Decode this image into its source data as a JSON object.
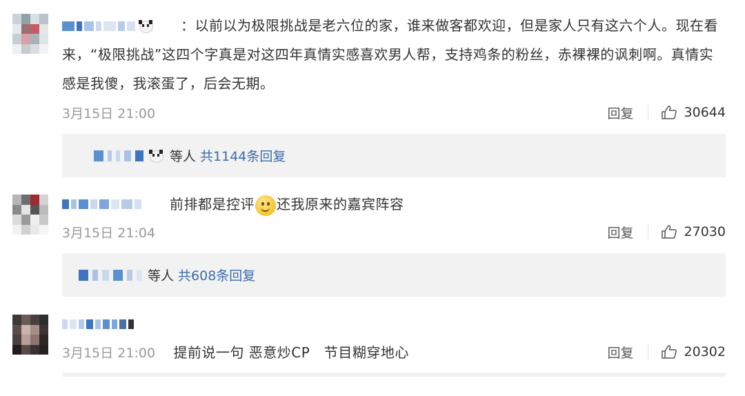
{
  "comments": [
    {
      "text": "以前以为极限挑战是老六位的家，谁来做客都欢迎，但是家人只有这六个人。现在看来，“极限挑战”这四个字真是对这四年真情实感喜欢男人帮，支持鸡条的粉丝，赤裸裸的讽刺啊。真情实感是我傻，我滚蛋了，后会无期。",
      "colon": "：",
      "time": "3月15日 21:00",
      "reply_label": "回复",
      "likes": "30644",
      "replies_etc": "等人",
      "replies_count": "共1144条回复"
    },
    {
      "text_before_emoji": "前排都是控评",
      "text_after_emoji": "还我原来的嘉宾阵容",
      "emoji": "smile-emoji",
      "time": "3月15日 21:04",
      "reply_label": "回复",
      "likes": "27030",
      "replies_etc": "等人",
      "replies_count": "共608条回复"
    },
    {
      "text": "提前说一句 恶意炒CP   节目糊穿地心",
      "time": "3月15日 21:00",
      "reply_label": "回复",
      "likes": "20302"
    }
  ],
  "colors": {
    "link": "#3b6cab",
    "meta": "#999999",
    "reply_bg": "#f2f2f2"
  }
}
